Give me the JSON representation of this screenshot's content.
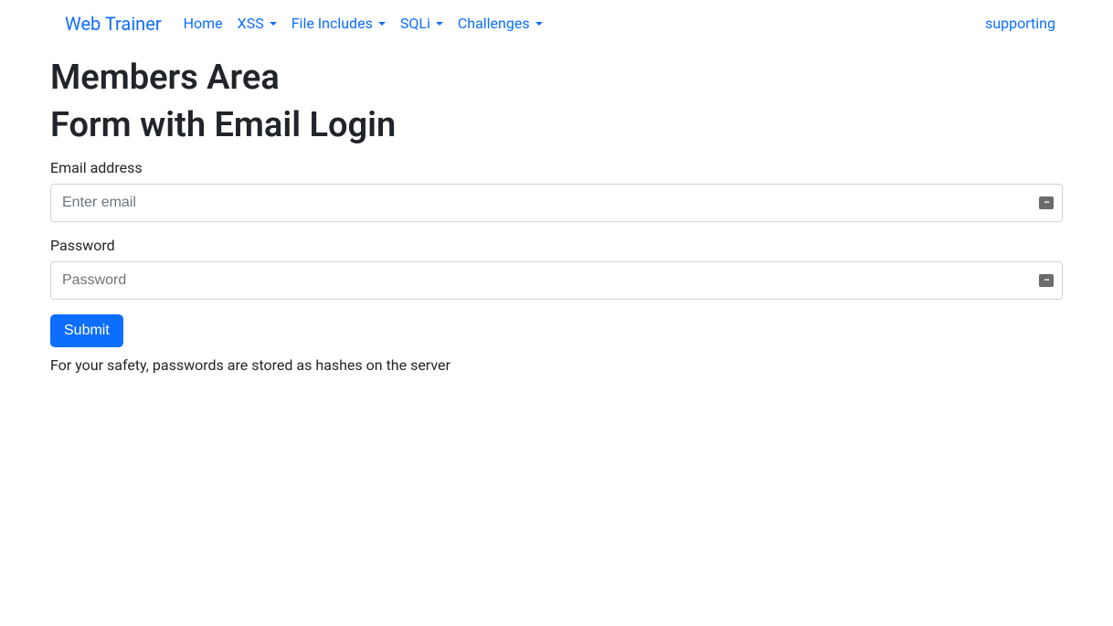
{
  "navbar": {
    "brand": "Web Trainer",
    "items": [
      {
        "label": "Home",
        "dropdown": false
      },
      {
        "label": "XSS",
        "dropdown": true
      },
      {
        "label": "File Includes",
        "dropdown": true
      },
      {
        "label": "SQLi",
        "dropdown": true
      },
      {
        "label": "Challenges",
        "dropdown": true
      }
    ],
    "right_link": "supporting"
  },
  "page": {
    "heading1": "Members Area",
    "heading2": "Form with Email Login"
  },
  "form": {
    "email_label": "Email address",
    "email_placeholder": "Enter email",
    "email_value": "",
    "password_label": "Password",
    "password_placeholder": "Password",
    "password_value": "",
    "submit_label": "Submit",
    "help_text": "For your safety, passwords are stored as hashes on the server"
  }
}
